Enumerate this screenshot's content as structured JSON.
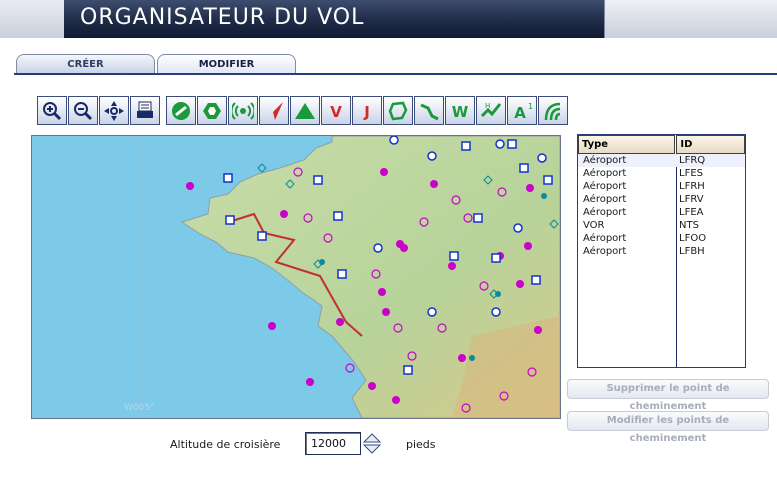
{
  "window": {
    "title": "ORGANISATEUR DU VOL"
  },
  "tabs": [
    {
      "label": "CRÉER"
    },
    {
      "label": "MODIFIER"
    }
  ],
  "toolbar": {
    "buttons": [
      {
        "name": "zoom-in-icon"
      },
      {
        "name": "zoom-out-icon"
      },
      {
        "name": "center-icon"
      },
      {
        "name": "print-icon"
      },
      {
        "name": "airport-filter-icon"
      },
      {
        "name": "ndb-filter-icon"
      },
      {
        "name": "vor-filter-icon"
      },
      {
        "name": "route-filter-icon"
      },
      {
        "name": "terrain-filter-icon"
      },
      {
        "name": "victor-airways-icon",
        "label": "V"
      },
      {
        "name": "jet-airways-icon",
        "label": "J"
      },
      {
        "name": "boundaries-icon"
      },
      {
        "name": "waypoints-icon"
      },
      {
        "name": "weather-icon",
        "label": "W"
      },
      {
        "name": "airspace-icon"
      },
      {
        "name": "altitude-icon",
        "label": "A"
      },
      {
        "name": "approach-icon"
      }
    ]
  },
  "map": {
    "longitude_label": "W005°"
  },
  "waypoint_list": {
    "columns": [
      "Type",
      "ID"
    ],
    "rows": [
      {
        "type": "Aéroport",
        "id": "LFRQ"
      },
      {
        "type": "Aéroport",
        "id": "LFES"
      },
      {
        "type": "Aéroport",
        "id": "LFRH"
      },
      {
        "type": "Aéroport",
        "id": "LFRV"
      },
      {
        "type": "Aéroport",
        "id": "LFEA"
      },
      {
        "type": "VOR",
        "id": "NTS"
      },
      {
        "type": "Aéroport",
        "id": "LFOO"
      },
      {
        "type": "Aéroport",
        "id": "LFBH"
      }
    ]
  },
  "buttons": {
    "delete_waypoint": "Supprimer le point de cheminement",
    "edit_waypoints": "Modifier les points de cheminement"
  },
  "cruise": {
    "label": "Altitude de croisière",
    "value": "12000",
    "unit": "pieds"
  },
  "colors": {
    "route": "#d43030",
    "airport": "#cc00cc",
    "vor": "#0033cc",
    "sea": "#7cc9e8",
    "land": "#b9d39a"
  }
}
